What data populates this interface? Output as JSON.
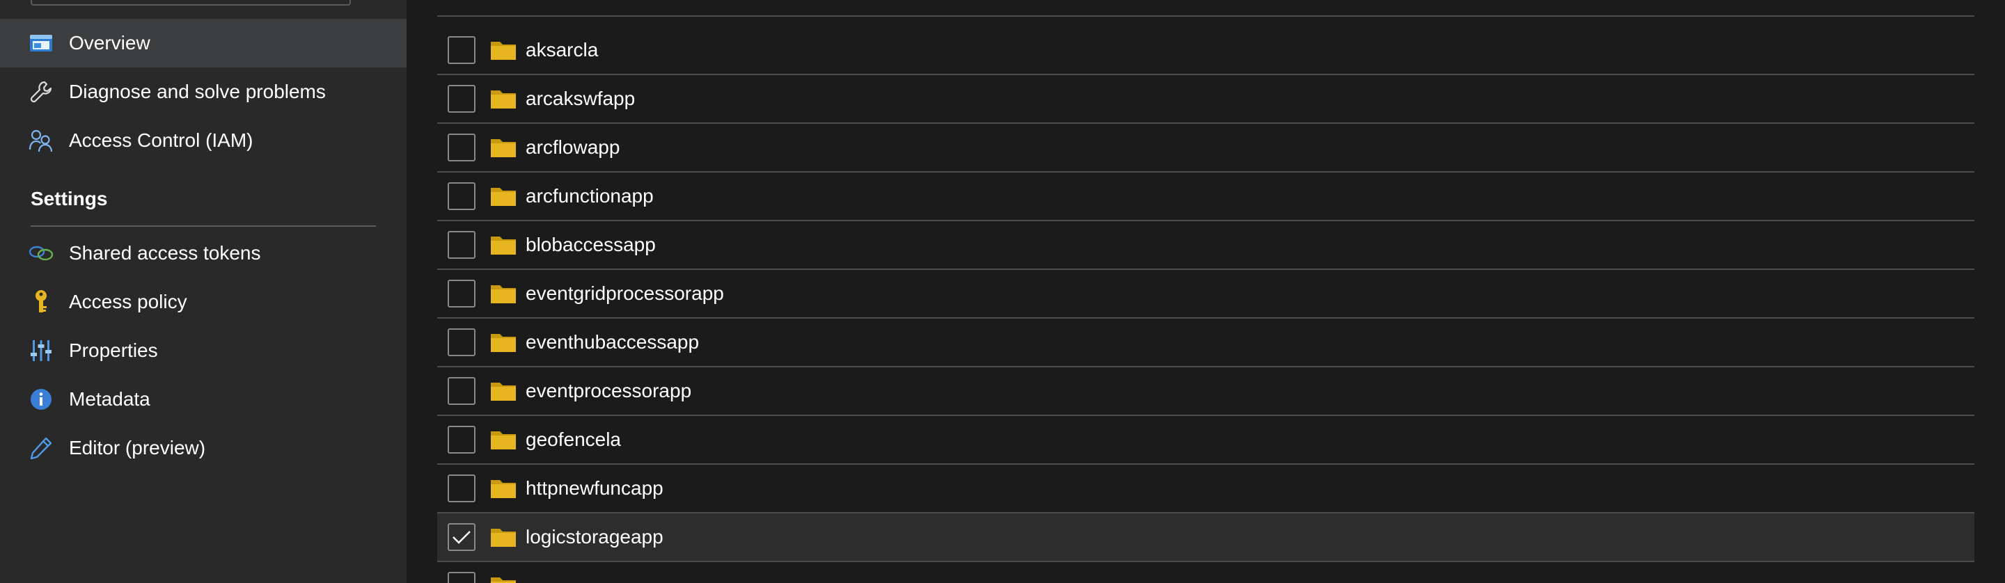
{
  "sidebar": {
    "items_top": [
      {
        "label": "Overview",
        "icon": "overview-icon",
        "selected": true
      },
      {
        "label": "Diagnose and solve problems",
        "icon": "wrench-icon",
        "selected": false
      },
      {
        "label": "Access Control (IAM)",
        "icon": "people-icon",
        "selected": false
      }
    ],
    "section_title": "Settings",
    "items_settings": [
      {
        "label": "Shared access tokens",
        "icon": "link-icon"
      },
      {
        "label": "Access policy",
        "icon": "key-icon"
      },
      {
        "label": "Properties",
        "icon": "sliders-icon"
      },
      {
        "label": "Metadata",
        "icon": "info-icon"
      },
      {
        "label": "Editor (preview)",
        "icon": "pencil-icon"
      }
    ]
  },
  "list": {
    "rows": [
      {
        "name": "aksarcla",
        "checked": false
      },
      {
        "name": "arcakswfapp",
        "checked": false
      },
      {
        "name": "arcflowapp",
        "checked": false
      },
      {
        "name": "arcfunctionapp",
        "checked": false
      },
      {
        "name": "blobaccessapp",
        "checked": false
      },
      {
        "name": "eventgridprocessorapp",
        "checked": false
      },
      {
        "name": "eventhubaccessapp",
        "checked": false
      },
      {
        "name": "eventprocessorapp",
        "checked": false
      },
      {
        "name": "geofencela",
        "checked": false
      },
      {
        "name": "httpnewfuncapp",
        "checked": false
      },
      {
        "name": "logicstorageapp",
        "checked": true
      }
    ]
  },
  "colors": {
    "folder": "#e6b51f",
    "folder_tab": "#c99a10",
    "sidebar_bg": "#292929",
    "selected_bg": "#3b3d3f",
    "main_bg": "#1b1b1b",
    "divider": "#4d4d4d"
  }
}
